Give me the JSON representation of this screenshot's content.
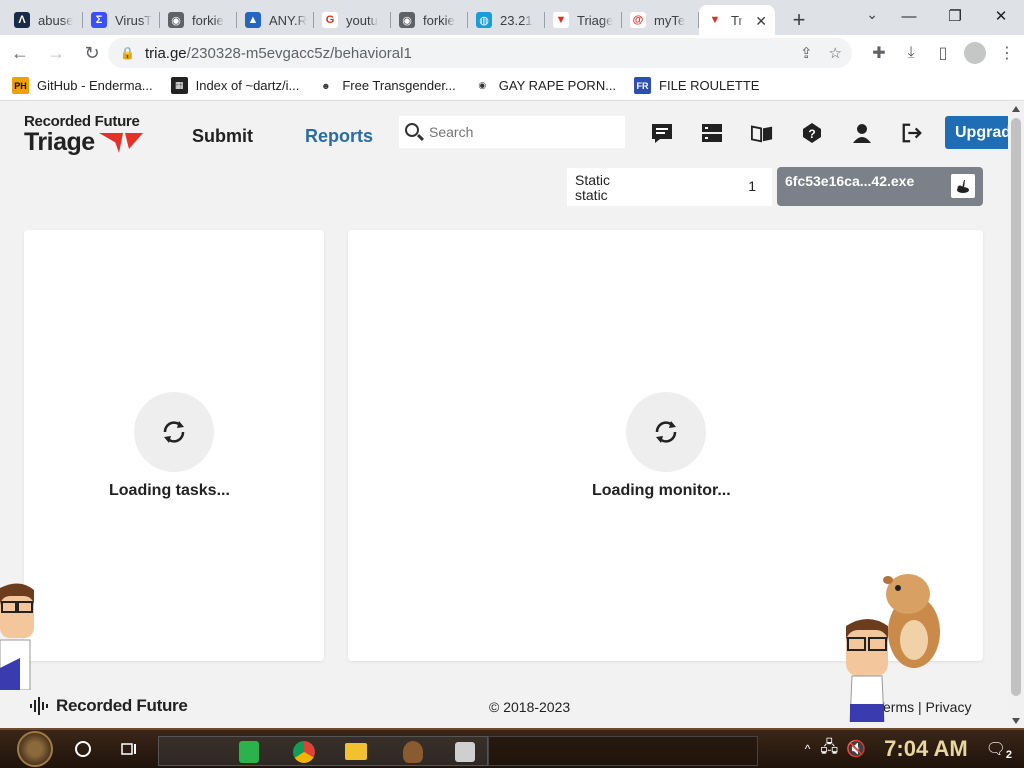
{
  "browser": {
    "tabs": [
      {
        "title": "abuse",
        "fav_color": "#1a2b4a",
        "fav_char": "Λ"
      },
      {
        "title": "VirusT",
        "fav_color": "#394eff",
        "fav_char": "Σ"
      },
      {
        "title": "forkie",
        "fav_color": "#5f6368",
        "fav_char": "◉"
      },
      {
        "title": "ANY.R",
        "fav_color": "#2565c0",
        "fav_char": "▲"
      },
      {
        "title": "youtu",
        "fav_color": "#ffffff",
        "fav_char": "G"
      },
      {
        "title": "forkie",
        "fav_color": "#5f6368",
        "fav_char": "◉"
      },
      {
        "title": "23.21",
        "fav_color": "#1a9ed8",
        "fav_char": "◍"
      },
      {
        "title": "Triage",
        "fav_color": "#ffffff",
        "fav_char": "▼"
      },
      {
        "title": "myTe",
        "fav_color": "#ffffff",
        "fav_char": "@"
      },
      {
        "title": "Tr",
        "fav_color": "#ffffff",
        "fav_char": "▼",
        "active": true
      }
    ],
    "url_host": "tria.ge",
    "url_path": "/230328-m5evgacc5z/behavioral1",
    "bookmarks": [
      {
        "label": "GitHub - Enderma...",
        "fav": "PH"
      },
      {
        "label": "Index of ~dartz/i...",
        "fav": "▦"
      },
      {
        "label": "Free Transgender...",
        "fav": "☻"
      },
      {
        "label": "GAY RAPE PORN...",
        "fav": "◉"
      },
      {
        "label": "FILE ROULETTE",
        "fav": "FR"
      }
    ]
  },
  "site": {
    "logo_top": "Recorded Future",
    "logo_bottom": "Triage",
    "nav": {
      "submit": "Submit",
      "reports": "Reports"
    },
    "search_placeholder": "Search",
    "upgrade_label": "Upgrad",
    "static_box": {
      "line1": "Static",
      "line2": "static",
      "count": "1"
    },
    "file_name": "6fc53e16ca...42.exe",
    "left_card_text": "Loading tasks...",
    "right_card_text": "Loading monitor...",
    "footer_logo": "Recorded Future",
    "copyright": "© 2018-2023",
    "footer_links": [
      "Terms",
      "Privacy"
    ]
  },
  "taskbar": {
    "clock": "7:04 AM",
    "notifications": "2"
  }
}
